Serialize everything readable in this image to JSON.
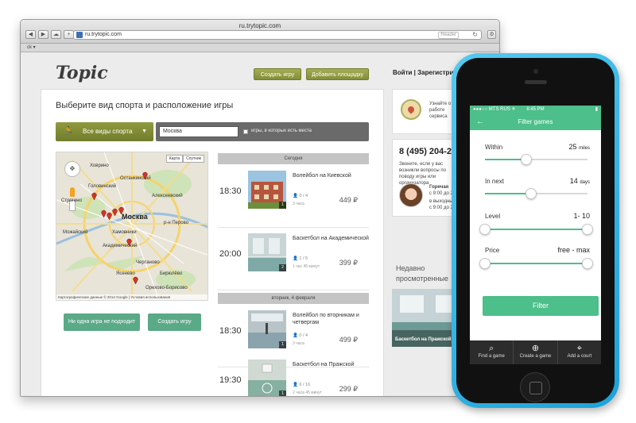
{
  "browser": {
    "window_title": "ru.trytopic.com",
    "url": "ru.trytopic.com",
    "reader_label": "Reader",
    "bookmarks_label": "ck ▾",
    "nav_back": "◀",
    "nav_forward": "▶",
    "nav_cloud": "☁",
    "nav_add": "+",
    "reload": "↻",
    "settings": "⚙"
  },
  "site": {
    "logo": "Topic",
    "create_game_btn": "Создать игру",
    "add_court_btn": "Добавить площадку",
    "login": "Войти",
    "separator": "|",
    "register": "Зарегистрироваться"
  },
  "search": {
    "title": "Выберите вид спорта и расположение игры",
    "sport_dropdown": "Все виды спорта",
    "sport_icon": "running-person-icon",
    "caret": "▼",
    "city_value": "Москва",
    "places_checkbox_label": "игры, в которых есть места"
  },
  "map": {
    "tab_map": "Карта",
    "tab_satellite": "Спутник",
    "labels": [
      "Останкинский",
      "Москва",
      "Хамовники",
      "р-н Перово",
      "Академический",
      "Можайский",
      "Ясенево",
      "Головинский",
      "Бирюлёво",
      "Чертаново",
      "Орехово-Борисово",
      "Строгино",
      "Алексеевский",
      "Ховрино"
    ],
    "copyright": "Картографические данные © 2014 Google | Условия использования",
    "zoom_symbol": "✥"
  },
  "actions": {
    "no_game_btn": "Ни одна игра не подходит",
    "create_game_btn": "Создать игру"
  },
  "games": {
    "today_header": "Сегодня",
    "tuesday_header": "вторник, 4 февраля",
    "list": [
      {
        "time": "18:30",
        "title": "Волейбол на Киевской",
        "players": "0 / 4",
        "age": "3 часа",
        "price": "449 ₽",
        "num": "1"
      },
      {
        "time": "20:00",
        "title": "Баскетбол на Академической",
        "players": "1 / 5",
        "age": "1 час 45 минут",
        "price": "399 ₽",
        "num": "2"
      },
      {
        "time": "18:30",
        "title": "Волейбол по вторникам и четвергам",
        "players": "0 / 4",
        "age": "3 часа",
        "price": "499 ₽",
        "num": "1"
      },
      {
        "time": "19:30",
        "title": "Баскетбол на Пражской",
        "players": "6 / 16",
        "age": "2 часа 45 минут",
        "price": "299 ₽",
        "num": "1"
      }
    ]
  },
  "sidebar": {
    "promo_text": "Узнайте о работе сервиса",
    "phone": "8 (495) 204-27",
    "call_text": "Звоните, если у вас возникли вопросы по поводу игры или организатора",
    "hotline_title": "Горячая",
    "hours1": "с 9:00 до 2",
    "hours2": "в выходные",
    "hours3": "с 9:00 до 2",
    "recent_title": "Недавно просмотренные",
    "recent_caption": "Баскетбол на Пражской"
  },
  "phone_app": {
    "carrier": "●●●○○ MTS RUS ✈",
    "time": "8:45 PM",
    "battery": "▮",
    "back_arrow": "←",
    "title": "Filter games",
    "filters": [
      {
        "label": "Within",
        "value": "25",
        "unit": "miles",
        "level": 0.4
      },
      {
        "label": "In next",
        "value": "14",
        "unit": "days",
        "level": 0.45
      },
      {
        "label": "Level",
        "value": "1- 10",
        "unit": "",
        "range": [
          0,
          1
        ]
      },
      {
        "label": "Price",
        "value": "free - max",
        "unit": "",
        "range": [
          0,
          1
        ]
      }
    ],
    "filter_button": "Filter",
    "tabs": [
      {
        "label": "Find a game",
        "icon": "search-icon",
        "glyph": "⌕"
      },
      {
        "label": "Create a game",
        "icon": "plus-circle-icon",
        "glyph": "⊕"
      },
      {
        "label": "Add a court",
        "icon": "location-pin-icon",
        "glyph": "⌖"
      }
    ]
  },
  "colors": {
    "olive": "#8f9a3f",
    "green": "#4cbf8a",
    "phone_case": "#28b0e0"
  }
}
